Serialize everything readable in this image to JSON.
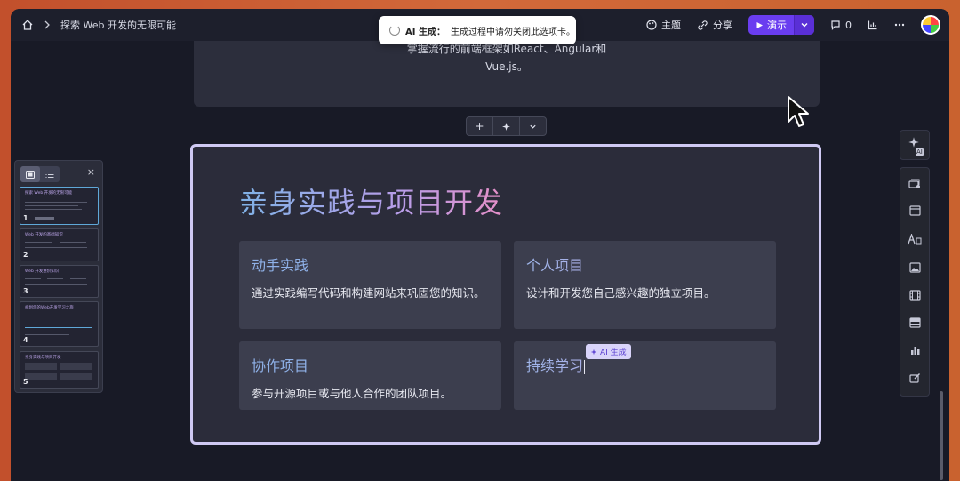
{
  "window": {
    "breadcrumb_title": "探索 Web 开发的无限可能"
  },
  "toolbar": {
    "theme_label": "主题",
    "share_label": "分享",
    "present_label": "演示",
    "comments_count": "0"
  },
  "toast": {
    "title": "AI 生成：",
    "message": "生成过程中请勿关闭此选项卡。"
  },
  "previous_card": {
    "line1": "掌握流行的前端框架如React、Angular和",
    "line2": "Vue.js。"
  },
  "mini_toolbar": {
    "add": "+"
  },
  "slide": {
    "title": "亲身实践与项目开发",
    "cards": [
      {
        "title": "动手实践",
        "body": "通过实践编写代码和构建网站来巩固您的知识。"
      },
      {
        "title": "个人项目",
        "body": "设计和开发您自己感兴趣的独立项目。"
      },
      {
        "title": "协作项目",
        "body": "参与开源项目或与他人合作的团队项目。"
      },
      {
        "title": "持续学习",
        "body": ""
      }
    ],
    "ai_tag": "AI 生成"
  },
  "left_panel": {
    "close": "×",
    "thumbnails": [
      {
        "num": "1",
        "title": "探索 Web 开发的无限可能"
      },
      {
        "num": "2",
        "title": "Web 开发的基础知识"
      },
      {
        "num": "3",
        "title": "Web 开发进阶知识"
      },
      {
        "num": "4",
        "title": "规划您的Web开发学习之旅"
      },
      {
        "num": "5",
        "title": "亲身实践与项目开发"
      }
    ]
  },
  "right_rail": {
    "ai_badge": "AI",
    "icons": [
      "card-icon",
      "layout-icon",
      "text-icon",
      "image-icon",
      "video-icon",
      "table-icon",
      "chart-icon",
      "edit-icon"
    ]
  }
}
